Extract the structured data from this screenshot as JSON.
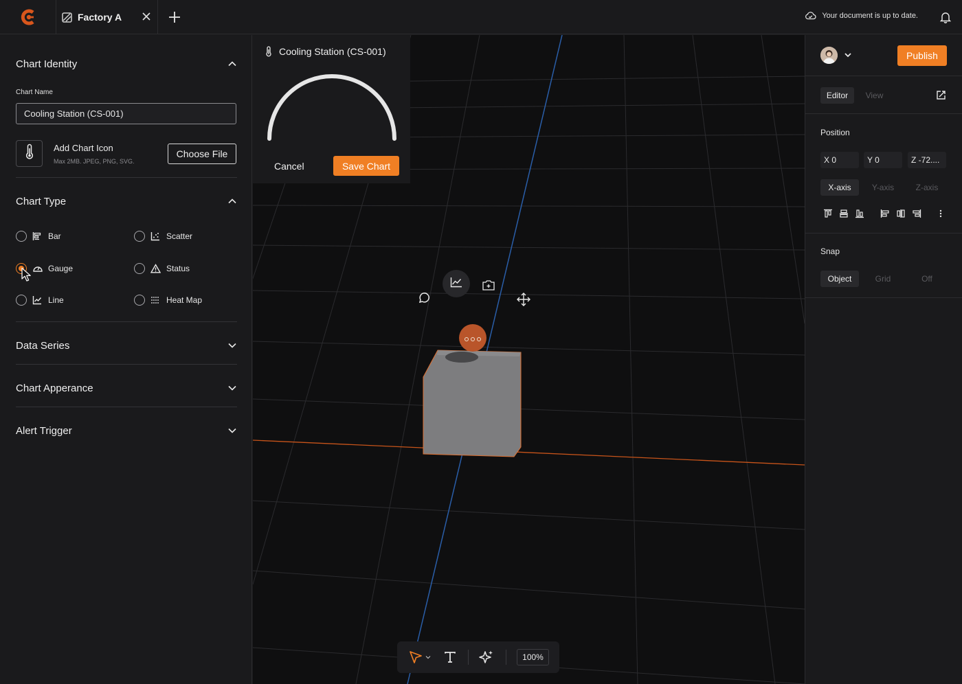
{
  "topbar": {
    "tab_label": "Factory A",
    "doc_status": "Your document is up to date.",
    "icons": [
      "logo-icon",
      "tab-file-icon",
      "close-icon",
      "plus-icon",
      "cloud-check-icon",
      "bell-icon"
    ]
  },
  "left_panel": {
    "chart_identity": {
      "title": "Chart Identity",
      "chart_name_label": "Chart Name",
      "chart_name_value": "Cooling Station (CS-001)",
      "add_icon_title": "Add Chart Icon",
      "add_icon_hint": "Max 2MB. JPEG, PNG, SVG.",
      "choose_file_label": "Choose File"
    },
    "chart_type": {
      "title": "Chart Type",
      "options": [
        {
          "label": "Bar",
          "checked": false,
          "icon": "bar-chart-icon"
        },
        {
          "label": "Scatter",
          "checked": false,
          "icon": "scatter-chart-icon"
        },
        {
          "label": "Gauge",
          "checked": true,
          "icon": "gauge-icon"
        },
        {
          "label": "Status",
          "checked": false,
          "icon": "warning-triangle-icon"
        },
        {
          "label": "Line",
          "checked": false,
          "icon": "line-chart-icon"
        },
        {
          "label": "Heat Map",
          "checked": false,
          "icon": "heatmap-icon"
        }
      ]
    },
    "collapsed_sections": [
      "Data Series",
      "Chart Apperance",
      "Alert Trigger"
    ]
  },
  "viewport": {
    "popup": {
      "title": "Cooling Station (CS-001)",
      "cancel_label": "Cancel",
      "save_label": "Save Chart"
    },
    "zoom": "100%",
    "colors": {
      "accent": "#f07f24",
      "grid": "#2a2a2d",
      "axis_blue": "#2a5ea8",
      "axis_orange": "#c8541a"
    }
  },
  "right_panel": {
    "publish_label": "Publish",
    "mode_tabs": [
      "Editor",
      "View"
    ],
    "position": {
      "title": "Position",
      "x": "X 0",
      "y": "Y 0",
      "z": "Z -72...."
    },
    "axis_tabs": [
      "X-axis",
      "Y-axis",
      "Z-axis"
    ],
    "snap": {
      "title": "Snap",
      "options": [
        "Object",
        "Grid",
        "Off"
      ]
    }
  }
}
